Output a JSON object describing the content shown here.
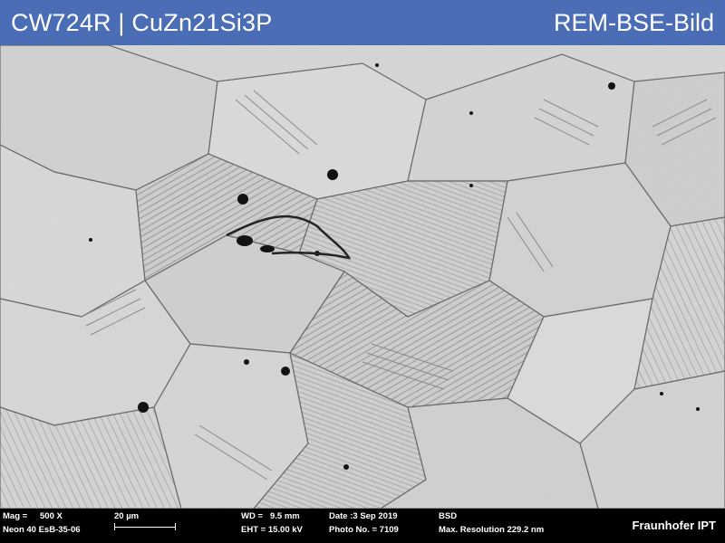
{
  "header": {
    "title": "CW724R | CuZn21Si3P",
    "image_type": "REM-BSE-Bild",
    "background_color": "#4a6db5"
  },
  "info_bar": {
    "mag_label": "Mag =",
    "mag_value": "500 X",
    "scale_label": "20 µm",
    "wd_label": "WD =",
    "wd_value": "9.5 mm",
    "date_label": "Date :3 Sep 2019",
    "detector": "BSD",
    "instrument": "Neon 40 EsB-35-06",
    "eht_label": "EHT = 15.00 kV",
    "photo_label": "Photo No. = 7109",
    "resolution_label": "Max. Resolution 229.2 nm",
    "logo_text": "Fraunhofer IPT"
  }
}
